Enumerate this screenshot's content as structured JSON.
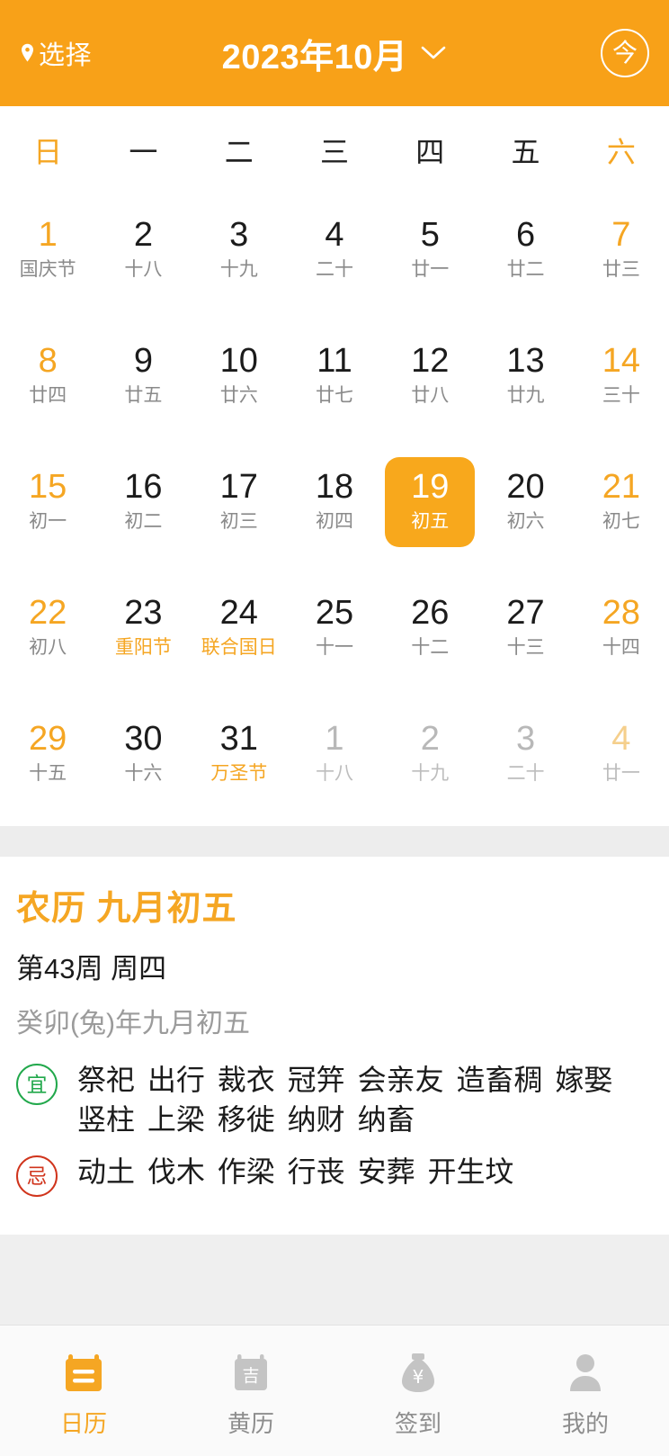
{
  "header": {
    "location_label": "选择",
    "location_icon": "location-pin-icon",
    "title": "2023年10月",
    "chevron_icon": "chevron-down-icon",
    "today_label": "今",
    "background_color": "#F8A118"
  },
  "calendar": {
    "weekdays": [
      {
        "label": "日",
        "weekend": true
      },
      {
        "label": "一",
        "weekend": false
      },
      {
        "label": "二",
        "weekend": false
      },
      {
        "label": "三",
        "weekend": false
      },
      {
        "label": "四",
        "weekend": false
      },
      {
        "label": "五",
        "weekend": false
      },
      {
        "label": "六",
        "weekend": true
      }
    ],
    "selected_color": "#F8A81C",
    "accent_color": "#F5A623",
    "days": [
      {
        "num": "1",
        "sub": "国庆节",
        "festival": true,
        "weekend": true,
        "out": false,
        "selected": false
      },
      {
        "num": "2",
        "sub": "十八",
        "festival": false,
        "weekend": false,
        "out": false,
        "selected": false
      },
      {
        "num": "3",
        "sub": "十九",
        "festival": false,
        "weekend": false,
        "out": false,
        "selected": false
      },
      {
        "num": "4",
        "sub": "二十",
        "festival": false,
        "weekend": false,
        "out": false,
        "selected": false
      },
      {
        "num": "5",
        "sub": "廿一",
        "festival": false,
        "weekend": false,
        "out": false,
        "selected": false
      },
      {
        "num": "6",
        "sub": "廿二",
        "festival": false,
        "weekend": false,
        "out": false,
        "selected": false
      },
      {
        "num": "7",
        "sub": "廿三",
        "festival": false,
        "weekend": true,
        "out": false,
        "selected": false
      },
      {
        "num": "8",
        "sub": "廿四",
        "festival": false,
        "weekend": true,
        "out": false,
        "selected": false
      },
      {
        "num": "9",
        "sub": "廿五",
        "festival": false,
        "weekend": false,
        "out": false,
        "selected": false
      },
      {
        "num": "10",
        "sub": "廿六",
        "festival": false,
        "weekend": false,
        "out": false,
        "selected": false
      },
      {
        "num": "11",
        "sub": "廿七",
        "festival": false,
        "weekend": false,
        "out": false,
        "selected": false
      },
      {
        "num": "12",
        "sub": "廿八",
        "festival": false,
        "weekend": false,
        "out": false,
        "selected": false
      },
      {
        "num": "13",
        "sub": "廿九",
        "festival": false,
        "weekend": false,
        "out": false,
        "selected": false
      },
      {
        "num": "14",
        "sub": "三十",
        "festival": false,
        "weekend": true,
        "out": false,
        "selected": false
      },
      {
        "num": "15",
        "sub": "初一",
        "festival": false,
        "weekend": true,
        "out": false,
        "selected": false
      },
      {
        "num": "16",
        "sub": "初二",
        "festival": false,
        "weekend": false,
        "out": false,
        "selected": false
      },
      {
        "num": "17",
        "sub": "初三",
        "festival": false,
        "weekend": false,
        "out": false,
        "selected": false
      },
      {
        "num": "18",
        "sub": "初四",
        "festival": false,
        "weekend": false,
        "out": false,
        "selected": false
      },
      {
        "num": "19",
        "sub": "初五",
        "festival": false,
        "weekend": false,
        "out": false,
        "selected": true
      },
      {
        "num": "20",
        "sub": "初六",
        "festival": false,
        "weekend": false,
        "out": false,
        "selected": false
      },
      {
        "num": "21",
        "sub": "初七",
        "festival": false,
        "weekend": true,
        "out": false,
        "selected": false
      },
      {
        "num": "22",
        "sub": "初八",
        "festival": false,
        "weekend": true,
        "out": false,
        "selected": false
      },
      {
        "num": "23",
        "sub": "重阳节",
        "festival": true,
        "weekend": false,
        "out": false,
        "selected": false
      },
      {
        "num": "24",
        "sub": "联合国日",
        "festival": true,
        "weekend": false,
        "out": false,
        "selected": false
      },
      {
        "num": "25",
        "sub": "十一",
        "festival": false,
        "weekend": false,
        "out": false,
        "selected": false
      },
      {
        "num": "26",
        "sub": "十二",
        "festival": false,
        "weekend": false,
        "out": false,
        "selected": false
      },
      {
        "num": "27",
        "sub": "十三",
        "festival": false,
        "weekend": false,
        "out": false,
        "selected": false
      },
      {
        "num": "28",
        "sub": "十四",
        "festival": false,
        "weekend": true,
        "out": false,
        "selected": false
      },
      {
        "num": "29",
        "sub": "十五",
        "festival": false,
        "weekend": true,
        "out": false,
        "selected": false
      },
      {
        "num": "30",
        "sub": "十六",
        "festival": false,
        "weekend": false,
        "out": false,
        "selected": false
      },
      {
        "num": "31",
        "sub": "万圣节",
        "festival": true,
        "weekend": false,
        "out": false,
        "selected": false
      },
      {
        "num": "1",
        "sub": "十八",
        "festival": false,
        "weekend": false,
        "out": true,
        "selected": false
      },
      {
        "num": "2",
        "sub": "十九",
        "festival": false,
        "weekend": false,
        "out": true,
        "selected": false
      },
      {
        "num": "3",
        "sub": "二十",
        "festival": false,
        "weekend": false,
        "out": true,
        "selected": false
      },
      {
        "num": "4",
        "sub": "廿一",
        "festival": false,
        "weekend": true,
        "out": true,
        "selected": false
      }
    ]
  },
  "detail": {
    "lunar_title": "农历 九月初五",
    "week_line": "第43周 周四",
    "ganzhi_line": "癸卯(兔)年九月初五",
    "yi": {
      "badge": "宜",
      "badge_color": "#21a84b",
      "items": "祭祀 出行 裁衣 冠笄 会亲友 造畜稠 嫁娶 竖柱 上梁 移徙 纳财 纳畜"
    },
    "ji": {
      "badge": "忌",
      "badge_color": "#d0341c",
      "items": "动土 伐木 作梁 行丧 安葬 开生坟"
    }
  },
  "tabbar": {
    "items": [
      {
        "label": "日历",
        "icon": "calendar-icon",
        "active": true
      },
      {
        "label": "黄历",
        "icon": "almanac-calendar-icon",
        "active": false
      },
      {
        "label": "签到",
        "icon": "money-bag-icon",
        "active": false
      },
      {
        "label": "我的",
        "icon": "person-icon",
        "active": false
      }
    ]
  }
}
